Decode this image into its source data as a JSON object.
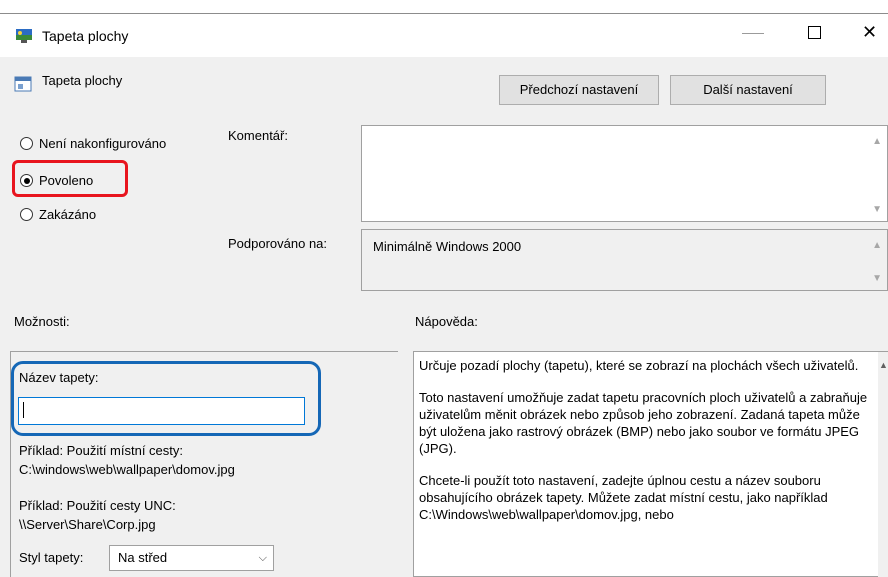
{
  "window": {
    "title": "Tapeta plochy",
    "controls": {
      "minimize": "—",
      "maximize": "☐",
      "close": "✕"
    }
  },
  "policy": {
    "title": "Tapeta plochy",
    "prev_button": "Předchozí nastavení",
    "next_button": "Další nastavení"
  },
  "state": {
    "options": [
      {
        "label": "Není nakonfigurováno",
        "checked": false
      },
      {
        "label": "Povoleno",
        "checked": true
      },
      {
        "label": "Zakázáno",
        "checked": false
      }
    ]
  },
  "comment": {
    "label": "Komentář:",
    "value": ""
  },
  "supported": {
    "label": "Podporováno na:",
    "value": "Minimálně Windows 2000"
  },
  "options_section": {
    "label": "Možnosti:",
    "wallpaper_name_label": "Název tapety:",
    "wallpaper_name_value": "",
    "example_local_label": "Příklad: Použití místní cesty:",
    "example_local_value": "C:\\windows\\web\\wallpaper\\domov.jpg",
    "example_unc_label": "Příklad: Použití cesty UNC:",
    "example_unc_value": "\\\\Server\\Share\\Corp.jpg",
    "style_label": "Styl tapety:",
    "style_value": "Na střed"
  },
  "help": {
    "label": "Nápověda:",
    "paragraphs": [
      "Určuje pozadí plochy (tapetu), které se zobrazí na plochách všech uživatelů.",
      "Toto nastavení umožňuje zadat tapetu pracovních ploch uživatelů a zabraňuje uživatelům měnit obrázek nebo způsob jeho zobrazení. Zadaná tapeta může být uložena jako rastrový obrázek (BMP) nebo jako soubor ve formátu JPEG (JPG).",
      "Chcete-li použít toto nastavení, zadejte úplnou cestu a název souboru obsahujícího obrázek tapety. Můžete zadat místní cestu, jako například C:\\Windows\\web\\wallpaper\\domov.jpg, nebo"
    ]
  },
  "colors": {
    "highlight_red": "#e8141e",
    "highlight_blue": "#1567b6",
    "input_focus": "#0078d7",
    "dialog_bg": "#f0f0f0"
  }
}
